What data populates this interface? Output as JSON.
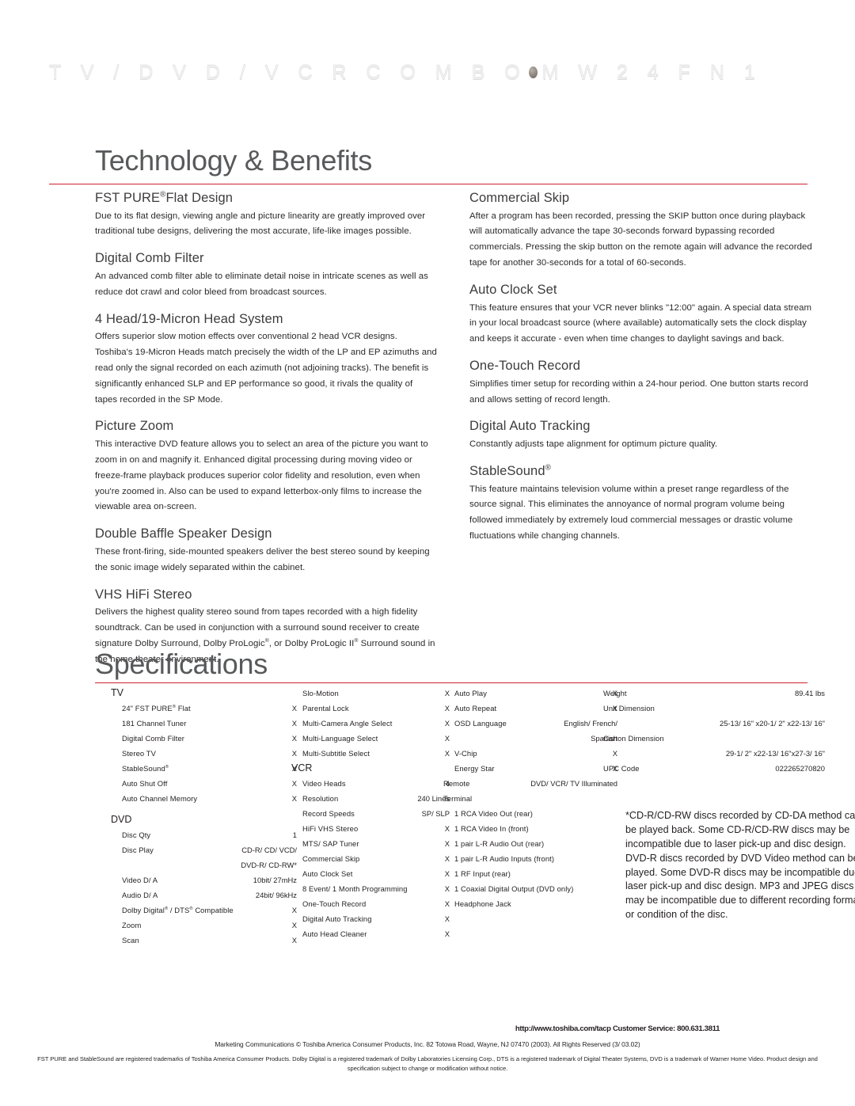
{
  "header": {
    "kicker_before": "T V / D V D / V C R    C O M B O",
    "bullet_icon": "oval-bullet",
    "kicker_after": "M W 2 4 F N 1"
  },
  "sections": {
    "technology": {
      "title": "Technology & Benefits",
      "accent_color": "#cf202e",
      "left_column": [
        {
          "heading": "FST PURE® Flat Design",
          "heading_main": "FST PURE",
          "heading_sup": "®",
          "heading_tail": "Flat Design",
          "body": "Due to its flat design, viewing angle and picture linearity are greatly improved over traditional tube designs, delivering the most accurate, life-like images possible."
        },
        {
          "heading": "Digital Comb Filter",
          "body": "An advanced comb filter able to eliminate detail noise in intricate scenes as well as reduce dot crawl and color bleed from broadcast sources."
        },
        {
          "heading": "4 Head/19-Micron Head System",
          "body": "Offers superior slow motion effects over conventional 2 head VCR designs. Toshiba's 19-Micron Heads match precisely the width of the LP and EP azimuths and read only the signal recorded on each azimuth (not adjoining tracks). The benefit is significantly enhanced SLP and EP performance so good, it rivals the quality of tapes recorded in the SP Mode."
        },
        {
          "heading": "Picture Zoom",
          "body": "This interactive DVD feature allows you to select an area of the picture you want to zoom in on and magnify it. Enhanced digital processing during moving video or freeze-frame playback produces superior color fidelity and resolution, even when you're zoomed in. Also can be used to expand letterbox-only films to increase the viewable area on-screen."
        },
        {
          "heading": "Double Baffle Speaker Design",
          "body": "These front-firing, side-mounted speakers deliver the best stereo sound by keeping the sonic image widely separated within the cabinet."
        },
        {
          "heading": "VHS HiFi Stereo",
          "body": "Delivers the highest quality stereo sound from tapes recorded with a high fidelity soundtrack. Can be used in conjunction with a surround sound receiver to create signature Dolby Surround, Dolby ProLogic®, or Dolby ProLogic II® Surround sound in the home theater environment."
        }
      ],
      "right_column": [
        {
          "heading": "Commercial Skip",
          "body": "After a program has been recorded, pressing the SKIP button once during playback will automatically advance the tape 30-seconds forward bypassing recorded commercials. Pressing the skip button on the remote again will advance the recorded tape for another 30-seconds for a total of 60-seconds."
        },
        {
          "heading": "Auto Clock Set",
          "body": "This feature ensures that your VCR never blinks \"12:00\" again. A special data stream in your local broadcast source (where available) automatically sets the clock display and keeps it accurate - even when time changes to daylight savings and back."
        },
        {
          "heading": "One-Touch Record",
          "body": "Simplifies timer setup for recording within a 24-hour period. One button starts record and allows setting of record length."
        },
        {
          "heading": "Digital Auto Tracking",
          "body": "Constantly adjusts tape alignment for optimum picture quality."
        },
        {
          "heading": "StableSound®",
          "heading_main": "StableSound",
          "heading_sup": "®",
          "body": "This feature maintains television volume within a preset range regardless of the source signal. This eliminates the annoyance of normal program volume being followed immediately by extremely loud commercial messages or drastic volume fluctuations while changing channels."
        }
      ]
    },
    "specifications": {
      "title": "Specifications",
      "columns": {
        "col1": [
          {
            "type": "group",
            "label": "TV"
          },
          {
            "type": "row",
            "label": "24\" FST PURE® Flat",
            "value": "X"
          },
          {
            "type": "row",
            "label": "181 Channel Tuner",
            "value": "X"
          },
          {
            "type": "row",
            "label": "Digital Comb Filter",
            "value": "X"
          },
          {
            "type": "row",
            "label": "Stereo TV",
            "value": "X"
          },
          {
            "type": "row",
            "label": "StableSound®",
            "value": "X"
          },
          {
            "type": "row",
            "label": "Auto Shut Off",
            "value": "X"
          },
          {
            "type": "row",
            "label": "Auto Channel Memory",
            "value": "X"
          },
          {
            "type": "spacer"
          },
          {
            "type": "group",
            "label": "DVD"
          },
          {
            "type": "row",
            "label": "Disc Qty",
            "value": "1"
          },
          {
            "type": "row",
            "label": "Disc Play",
            "value": "CD-R/ CD/ VCD/"
          },
          {
            "type": "contval",
            "label": "",
            "value": "DVD-R/ CD-RW*"
          },
          {
            "type": "row",
            "label": "Video D/ A",
            "value": "10bit/ 27mHz"
          },
          {
            "type": "row",
            "label": "Audio D/ A",
            "value": "24bit/ 96kHz"
          },
          {
            "type": "row",
            "label": "Dolby Digital® / DTS® Compatible",
            "value": "X"
          },
          {
            "type": "row",
            "label": "Zoom",
            "value": "X"
          },
          {
            "type": "row",
            "label": "Scan",
            "value": "X"
          }
        ],
        "col2": [
          {
            "type": "row",
            "label": "Slo-Motion",
            "value": "X"
          },
          {
            "type": "row",
            "label": "Parental Lock",
            "value": "X"
          },
          {
            "type": "row",
            "label": "Multi-Camera Angle Select",
            "value": "X"
          },
          {
            "type": "row",
            "label": "Multi-Language Select",
            "value": "X"
          },
          {
            "type": "row",
            "label": "Multi-Subtitle Select",
            "value": "X"
          },
          {
            "type": "group",
            "label": "VCR"
          },
          {
            "type": "row",
            "label": "Video Heads",
            "value": "4"
          },
          {
            "type": "row",
            "label": "Resolution",
            "value": "240 Lines"
          },
          {
            "type": "row",
            "label": "Record Speeds",
            "value": "SP/ SLP"
          },
          {
            "type": "row",
            "label": "HiFi VHS Stereo",
            "value": "X"
          },
          {
            "type": "row",
            "label": "MTS/ SAP Tuner",
            "value": "X"
          },
          {
            "type": "row",
            "label": "Commercial Skip",
            "value": "X"
          },
          {
            "type": "row",
            "label": "Auto Clock Set",
            "value": "X"
          },
          {
            "type": "row",
            "label": "8 Event/ 1 Month Programming",
            "value": "X"
          },
          {
            "type": "row",
            "label": "One-Touch Record",
            "value": "X"
          },
          {
            "type": "row",
            "label": "Digital Auto Tracking",
            "value": "X"
          },
          {
            "type": "row",
            "label": "Auto Head Cleaner",
            "value": "X"
          }
        ],
        "col3": [
          {
            "type": "row",
            "label": "Auto Play",
            "value": "X"
          },
          {
            "type": "row",
            "label": "Auto Repeat",
            "value": "X"
          },
          {
            "type": "row",
            "label": "OSD Language",
            "value": "English/ French/"
          },
          {
            "type": "contval",
            "label": "",
            "value": "Spanish"
          },
          {
            "type": "row",
            "label": "V-Chip",
            "value": "X"
          },
          {
            "type": "row",
            "label": "Energy Star",
            "value": "X"
          },
          {
            "type": "flush",
            "label": "Remote",
            "value": "DVD/ VCR/ TV Illuminated"
          },
          {
            "type": "flush",
            "label": "Terminal",
            "value": ""
          },
          {
            "type": "row",
            "label": "1 RCA Video Out (rear)",
            "value": ""
          },
          {
            "type": "row",
            "label": "1 RCA Video In (front)",
            "value": ""
          },
          {
            "type": "row",
            "label": "1 pair L-R Audio Out (rear)",
            "value": ""
          },
          {
            "type": "row",
            "label": "1 pair L-R Audio Inputs (front)",
            "value": ""
          },
          {
            "type": "row",
            "label": "1 RF Input (rear)",
            "value": ""
          },
          {
            "type": "row",
            "label": "1 Coaxial Digital Output (DVD only)",
            "value": ""
          },
          {
            "type": "row",
            "label": "Headphone Jack",
            "value": ""
          }
        ],
        "col4": [
          {
            "type": "flush",
            "label": "Weight",
            "value": "89.41 lbs"
          },
          {
            "type": "flush",
            "label": "Unit Dimension",
            "value": ""
          },
          {
            "type": "contval",
            "label": "",
            "value": "25-13/ 16\" x20-1/ 2\" x22-13/ 16\""
          },
          {
            "type": "flush",
            "label": "Carton Dimension",
            "value": ""
          },
          {
            "type": "contval",
            "label": "",
            "value": "29-1/ 2\" x22-13/ 16\"x27-3/ 16\""
          },
          {
            "type": "flush",
            "label": "UPC Code",
            "value": "022265270820"
          }
        ]
      },
      "footnote": "*CD-R/CD-RW discs recorded by CD-DA method can be played back. Some CD-R/CD-RW discs may be incompatible due to laser pick-up and disc design. DVD-R discs recorded by DVD Video method can be played. Some DVD-R discs may be incompatible due to laser pick-up and disc design. MP3 and JPEG discs may be incompatible due to different recording format or condition of the disc."
    }
  },
  "footer": {
    "url_line": "http://www.toshiba.com/tacp  Customer Service: 800.631.3811",
    "copyright_line": "Marketing Communications ©  Toshiba America Consumer Products, Inc. 82 Totowa Road, Wayne, NJ 07470  (2003).  All Rights Reserved (3/ 03.02)",
    "trademark_line": "FST PURE and StableSound are registered trademarks of Toshiba America Consumer Products. Dolby Digital is a registered trademark of Dolby Laboratories Licensing Corp., DTS is a registered trademark of Digital Theater Systems, DVD is a trademark of Warner Home Video. Product design and specification subject to change or modification without notice."
  }
}
